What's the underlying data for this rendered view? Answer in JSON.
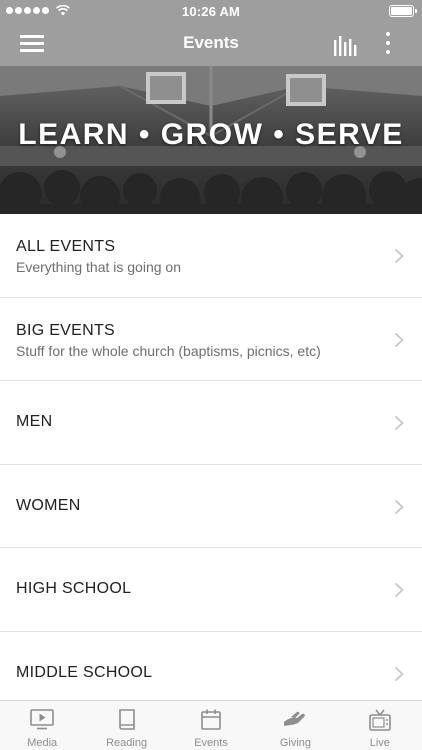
{
  "status_bar": {
    "time": "10:26 AM",
    "icons": [
      "signal-dots",
      "wifi-icon",
      "battery-icon"
    ]
  },
  "nav": {
    "title": "Events",
    "left_icon": "hamburger-menu-icon",
    "right_icons": [
      "stats-bars-icon",
      "more-vertical-icon"
    ]
  },
  "hero": {
    "text": "LEARN • GROW • SERVE"
  },
  "events": [
    {
      "title": "ALL EVENTS",
      "subtitle": "Everything that is going on"
    },
    {
      "title": "BIG EVENTS",
      "subtitle": "Stuff for the whole church (baptisms, picnics, etc)"
    },
    {
      "title": "MEN",
      "subtitle": ""
    },
    {
      "title": "WOMEN",
      "subtitle": ""
    },
    {
      "title": "HIGH SCHOOL",
      "subtitle": ""
    },
    {
      "title": "MIDDLE SCHOOL",
      "subtitle": ""
    }
  ],
  "tabs": [
    {
      "label": "Media",
      "icon": "play-screen-icon"
    },
    {
      "label": "Reading",
      "icon": "book-icon"
    },
    {
      "label": "Events",
      "icon": "calendar-icon"
    },
    {
      "label": "Giving",
      "icon": "giving-hand-icon"
    },
    {
      "label": "Live",
      "icon": "tv-icon"
    }
  ],
  "colors": {
    "bar_gray": "#9e9e9e",
    "tab_bar_bg": "#f8f8f8",
    "tab_icon": "#8e8e8e",
    "chevron": "#c7c7cc",
    "title_text": "#222222",
    "subtitle_text": "#6f6f6f"
  }
}
